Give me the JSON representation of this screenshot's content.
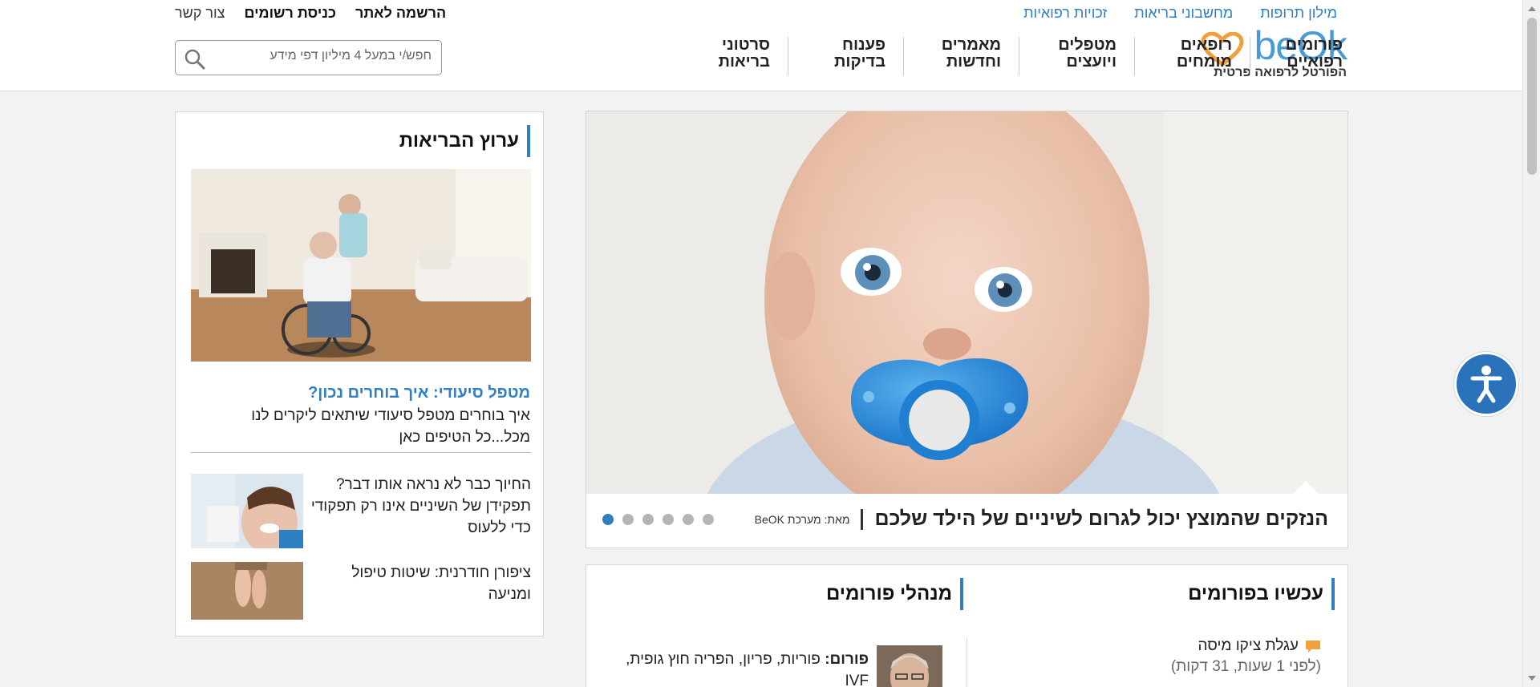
{
  "header": {
    "top_links": [
      "מילון תרופות",
      "מחשבוני בריאות",
      "זכויות רפואיות"
    ],
    "user_links": {
      "register": "הרשמה לאתר",
      "login": "כניסת רשומים",
      "contact": "צור קשר"
    },
    "logo": {
      "word": "beOk",
      "tagline": "הפורטל לרפואה פרטית"
    },
    "nav": [
      {
        "line1": "פורומים",
        "line2": "רפואיים"
      },
      {
        "line1": "רופאים",
        "line2": "מומחים"
      },
      {
        "line1": "מטפלים",
        "line2": "ויועצים"
      },
      {
        "line1": "מאמרים",
        "line2": "וחדשות"
      },
      {
        "line1": "פענוח",
        "line2": "בדיקות"
      },
      {
        "line1": "סרטוני",
        "line2": "בריאות"
      }
    ],
    "search": {
      "placeholder": "חפש/י במעל 4 מיליון דפי מידע"
    }
  },
  "hero": {
    "title": "הנזקים שהמוצץ יכול לגרום לשיניים של הילד שלכם",
    "source": "מאת: מערכת BeOK",
    "slides_count": 6,
    "active_slide": 1
  },
  "side": {
    "title": "ערוץ הבריאות",
    "feature": {
      "title": "מטפל סיעודי: איך בוחרים נכון?",
      "text": "איך בוחרים מטפל סיעודי שיתאים ליקרים לנו מכל...כל הטיפים כאן"
    },
    "items": [
      {
        "text": "החיוך כבר לא נראה אותו דבר? תפקידן של השיניים אינו רק תפקודי כדי ללעוס"
      },
      {
        "text": "ציפורן חודרנית: שיטות טיפול ומניעה"
      }
    ]
  },
  "forums": {
    "now_title": "עכשיו בפורומים",
    "managers_title": "מנהלי פורומים",
    "now_item": {
      "name": "עגלת ציקו מיסה",
      "time": "(לפני 1 שעות, 31 דקות)"
    },
    "manager": {
      "label": "פורום:",
      "text": "פוריות, פריון, הפריה חוץ גופית, IVF"
    }
  },
  "colors": {
    "accent": "#2f7fc1",
    "logo_orange": "#f0a03c",
    "access_blue": "#2a73ba"
  }
}
